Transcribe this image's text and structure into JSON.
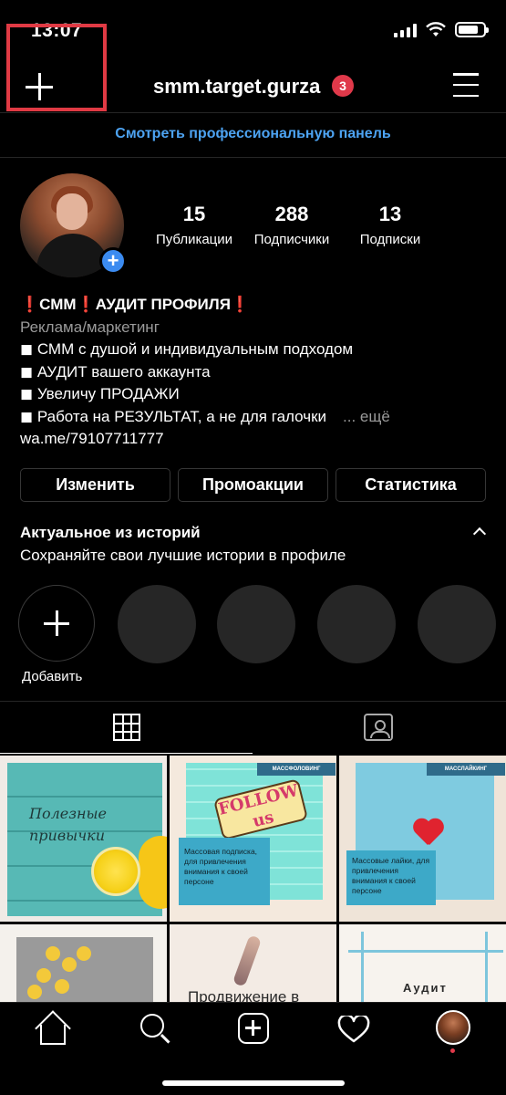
{
  "status_bar": {
    "time": "13:07"
  },
  "header": {
    "username": "smm.target.gurza",
    "notification_count": "3",
    "pro_dashboard_link": "Смотреть профессиональную панель"
  },
  "profile": {
    "stats": [
      {
        "value": "15",
        "label": "Публикации"
      },
      {
        "value": "288",
        "label": "Подписчики"
      },
      {
        "value": "13",
        "label": "Подписки"
      }
    ],
    "bio": {
      "name": "❗СММ❗АУДИТ ПРОФИЛЯ❗",
      "category": "Реклама/маркетинг",
      "lines": [
        "◼ СММ с душой и индивидуальным подходом",
        "◼ АУДИТ вашего аккаунта",
        "◼ Увеличу ПРОДАЖИ",
        "◼ Работа на РЕЗУЛЬТАТ, а не для галочки"
      ],
      "more": "... ещё",
      "link": "wa.me/79107711777"
    },
    "buttons": {
      "edit": "Изменить",
      "promotions": "Промоакции",
      "insights": "Статистика"
    }
  },
  "highlights": {
    "title": "Актуальное из историй",
    "subtitle": "Сохраняйте свои лучшие истории в профиле",
    "add_label": "Добавить"
  },
  "posts": [
    {
      "text": "Полезные привычки"
    },
    {
      "tag": "МАССФОЛОВИНГ",
      "sign": "FOLLOW us",
      "text": "Массовая подписка, для привлечения внимания к своей персоне"
    },
    {
      "tag": "МАССЛАЙКИНГ",
      "text": "Массовые лайки, для привлечения внимания к своей персоне"
    },
    {
      "text": ""
    },
    {
      "text": "Продвижение в"
    },
    {
      "text": "Аудит"
    }
  ],
  "icons": {
    "add": "plus-icon",
    "menu": "menu-icon",
    "grid": "grid-icon",
    "tagged": "tagged-icon",
    "nav": [
      "home-icon",
      "search-icon",
      "new-post-icon",
      "heart-icon",
      "profile-icon"
    ]
  },
  "colors": {
    "accent_link": "#4da3f2",
    "badge": "#e0394a",
    "highlight_box": "#e03a44"
  }
}
